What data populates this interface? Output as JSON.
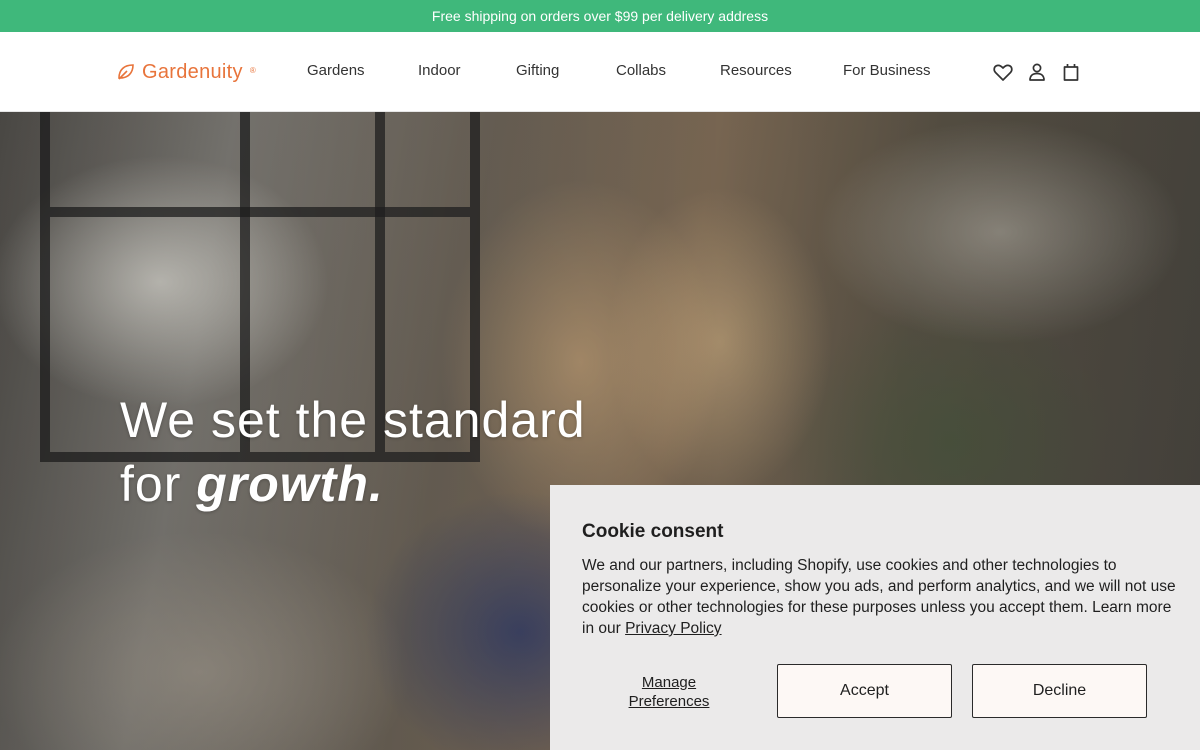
{
  "announcement": {
    "text": "Free shipping on orders over $99 per delivery address"
  },
  "brand": {
    "name": "Gardenuity",
    "registered": "®",
    "color": "#e8743b"
  },
  "nav": {
    "items": [
      {
        "label": "Gardens"
      },
      {
        "label": "Indoor"
      },
      {
        "label": "Gifting"
      },
      {
        "label": "Collabs"
      },
      {
        "label": "Resources"
      },
      {
        "label": "For Business"
      }
    ]
  },
  "header_icons": [
    "heart-icon",
    "account-icon",
    "cart-icon"
  ],
  "hero": {
    "line1": "We set the standard",
    "line2_prefix": "for ",
    "line2_emphasis": "growth."
  },
  "cookie": {
    "title": "Cookie consent",
    "body": "We and our partners, including Shopify, use cookies and other technologies to personalize your experience, show you ads, and perform analytics, and we will not use cookies or other technologies for these purposes unless you accept them. Learn more in our ",
    "privacy_link": "Privacy Policy",
    "manage_line1": "Manage",
    "manage_line2": "Preferences",
    "accept": "Accept",
    "decline": "Decline"
  },
  "colors": {
    "announcement_bg": "#3fb87b",
    "cookie_bg": "#ebeaea"
  }
}
